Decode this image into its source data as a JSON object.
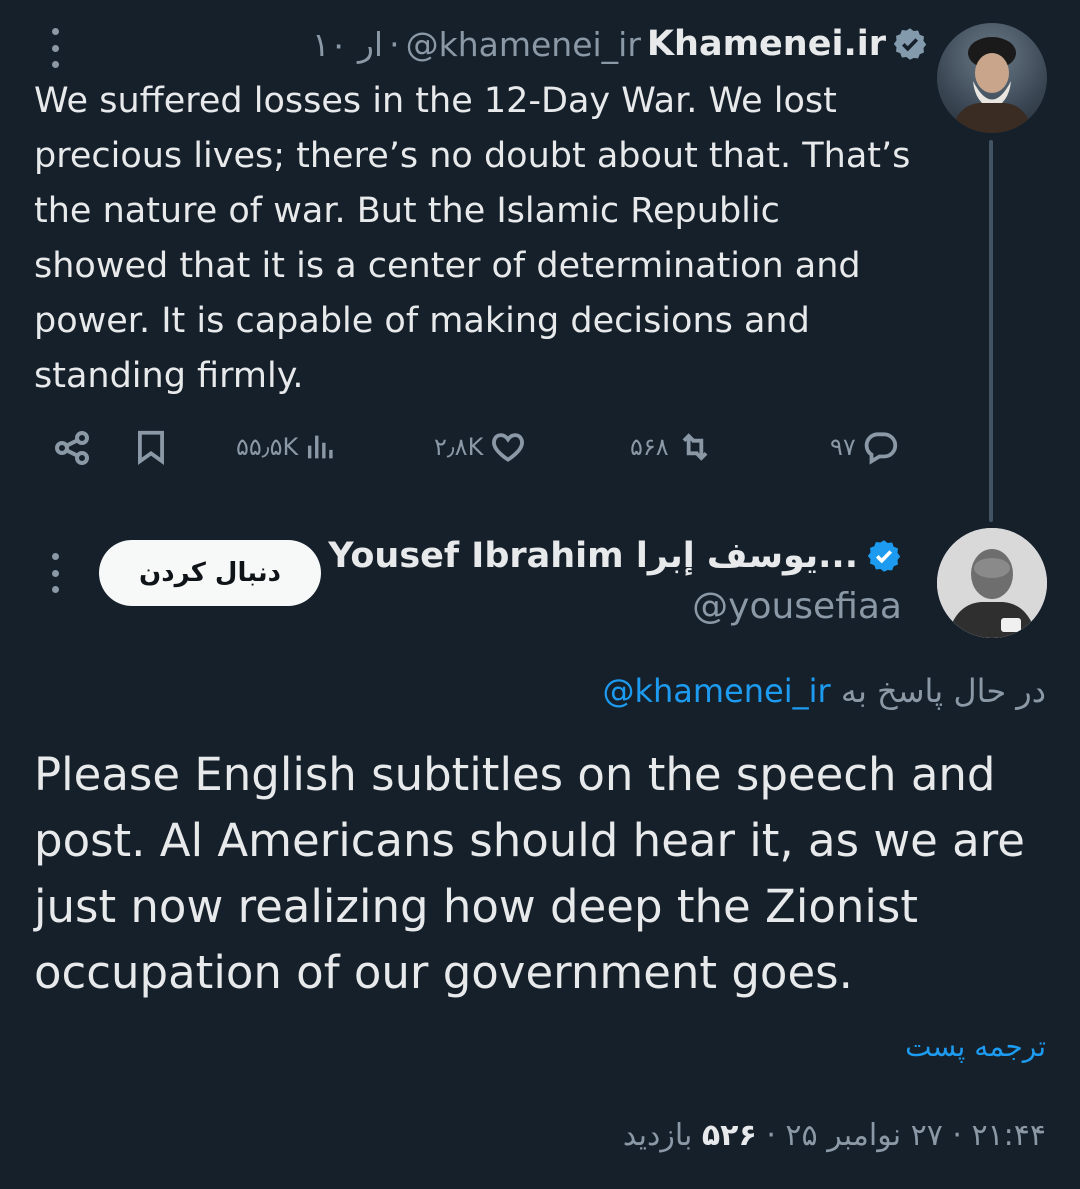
{
  "tweet1": {
    "author_name": "Khamenei.ir",
    "author_handle": "@khamenei_ir",
    "time": "۱۰ ار",
    "separator": "·",
    "text": "We suffered losses in the 12-Day War. We lost precious lives; there’s no doubt about that. That’s the nature of war. But the Islamic Republic showed that it is a center of determination and power. It is capable of making decisions and standing firmly.",
    "actions": {
      "replies": "۹۷",
      "reposts": "۵۶۸",
      "likes": "۲٫۸K",
      "views": "۵۵٫۵K"
    }
  },
  "tweet2": {
    "author_name": "Yousef Ibrahim يوسف إبرا...",
    "author_handle": "@yousefiaa",
    "follow_label": "دنبال کردن",
    "replying_prefix": "در حال پاسخ به",
    "replying_to": "@khamenei_ir",
    "text": "Please English subtitles on the speech and post.  Al Americans should hear it, as we are just now realizing how deep the Zionist occupation of our government goes.",
    "translate_label": "ترجمه پست",
    "meta_time_date": "۲۱:۴۴ · ۲۷ نوامبر ۲۵ ·",
    "meta_views": "۵۲۶",
    "meta_views_label": "بازدید"
  },
  "colors": {
    "background": "#15202b",
    "text": "#e7e9ea",
    "muted": "#8b98a5",
    "accent": "#1d9bf0",
    "thread_line": "#425364"
  },
  "icons": [
    "more-icon",
    "verified-badge-icon",
    "share-icon",
    "bookmark-icon",
    "views-icon",
    "like-icon",
    "repost-icon",
    "reply-icon"
  ]
}
